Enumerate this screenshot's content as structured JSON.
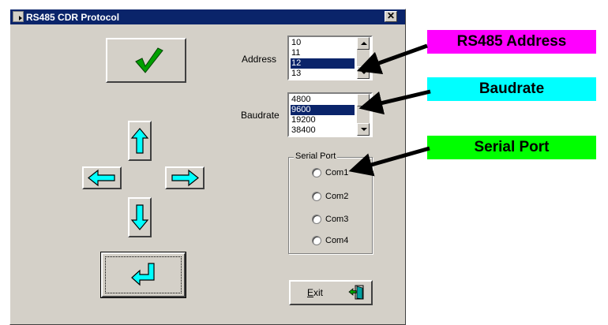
{
  "window": {
    "title": "RS485 CDR Protocol",
    "close_glyph": "✕"
  },
  "buttons": {
    "ok_icon": "check-icon",
    "enter_icon": "enter-arrow-icon",
    "up_icon": "arrow-up-icon",
    "down_icon": "arrow-down-icon",
    "left_icon": "arrow-left-icon",
    "right_icon": "arrow-right-icon",
    "exit_label": "Exit",
    "exit_mnemonic": "E",
    "exit_rest": "xit"
  },
  "address": {
    "label": "Address",
    "items": [
      "10",
      "11",
      "12",
      "13"
    ],
    "selected": "12"
  },
  "baudrate": {
    "label": "Baudrate",
    "items": [
      "4800",
      "9600",
      "19200",
      "38400"
    ],
    "selected": "9600"
  },
  "serial_port": {
    "label": "Serial Port",
    "options": [
      "Com1",
      "Com2",
      "Com3",
      "Com4"
    ]
  },
  "annotations": [
    {
      "text": "RS485 Address",
      "color": "#ff00ff"
    },
    {
      "text": "Baudrate",
      "color": "#00ffff"
    },
    {
      "text": "Serial Port",
      "color": "#00ff00"
    }
  ],
  "colors": {
    "titlebar": "#0a246a",
    "selection": "#0a246a",
    "face": "#d4d0c8",
    "arrow_fill": "#00ffff",
    "check": "#00a000"
  }
}
